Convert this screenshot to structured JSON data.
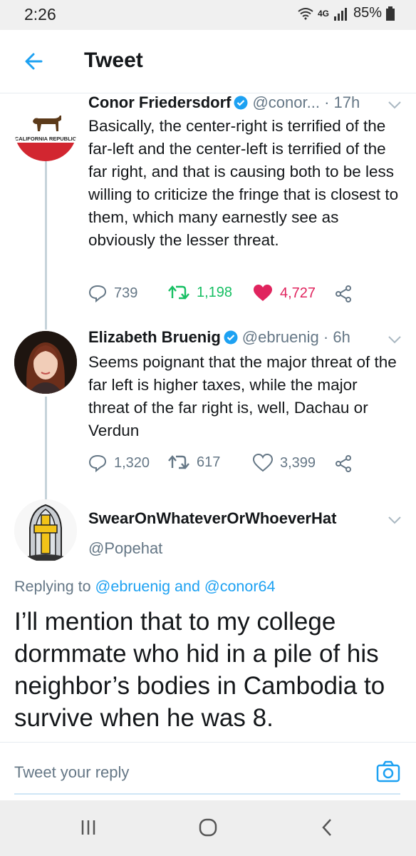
{
  "status": {
    "time": "2:26",
    "network": "4G",
    "battery": "85%"
  },
  "appbar": {
    "title": "Tweet"
  },
  "tweets": [
    {
      "name": "Conor Friedersdorf",
      "handle": "@conor...",
      "time": "· 17h",
      "text": "Basically, the center-right is terrified of the far-left and the center-left is terrified of the far right, and that is causing both to be less willing to criticize the fringe that is closest to them, which many earnestly see as obviously the lesser threat.",
      "avatar_text": "CALIFORNIA REPUBLIC",
      "replies": "739",
      "retweets": "1,198",
      "likes": "4,727"
    },
    {
      "name": "Elizabeth Bruenig",
      "handle": "@ebruenig",
      "time": "· 6h",
      "text": "Seems poignant that the major threat of the far left is higher taxes, while the major threat of the far right is, well, Dachau or Verdun",
      "replies": "1,320",
      "retweets": "617",
      "likes": "3,399"
    }
  ],
  "main_tweet": {
    "name": "SwearOnWhateverOrWhoeverHat",
    "handle": "@Popehat",
    "replying_prefix": "Replying to ",
    "mention1": "@ebruenig",
    "and": " and ",
    "mention2": "@conor64",
    "text": "I’ll mention that to my college dormmate who hid in a pile of his neighbor’s bodies in Cambodia to survive when he was 8."
  },
  "reply": {
    "placeholder": "Tweet your reply"
  },
  "colors": {
    "accent": "#1da1f2",
    "retweet": "#17bf63",
    "like": "#e0245e",
    "muted": "#657786"
  }
}
